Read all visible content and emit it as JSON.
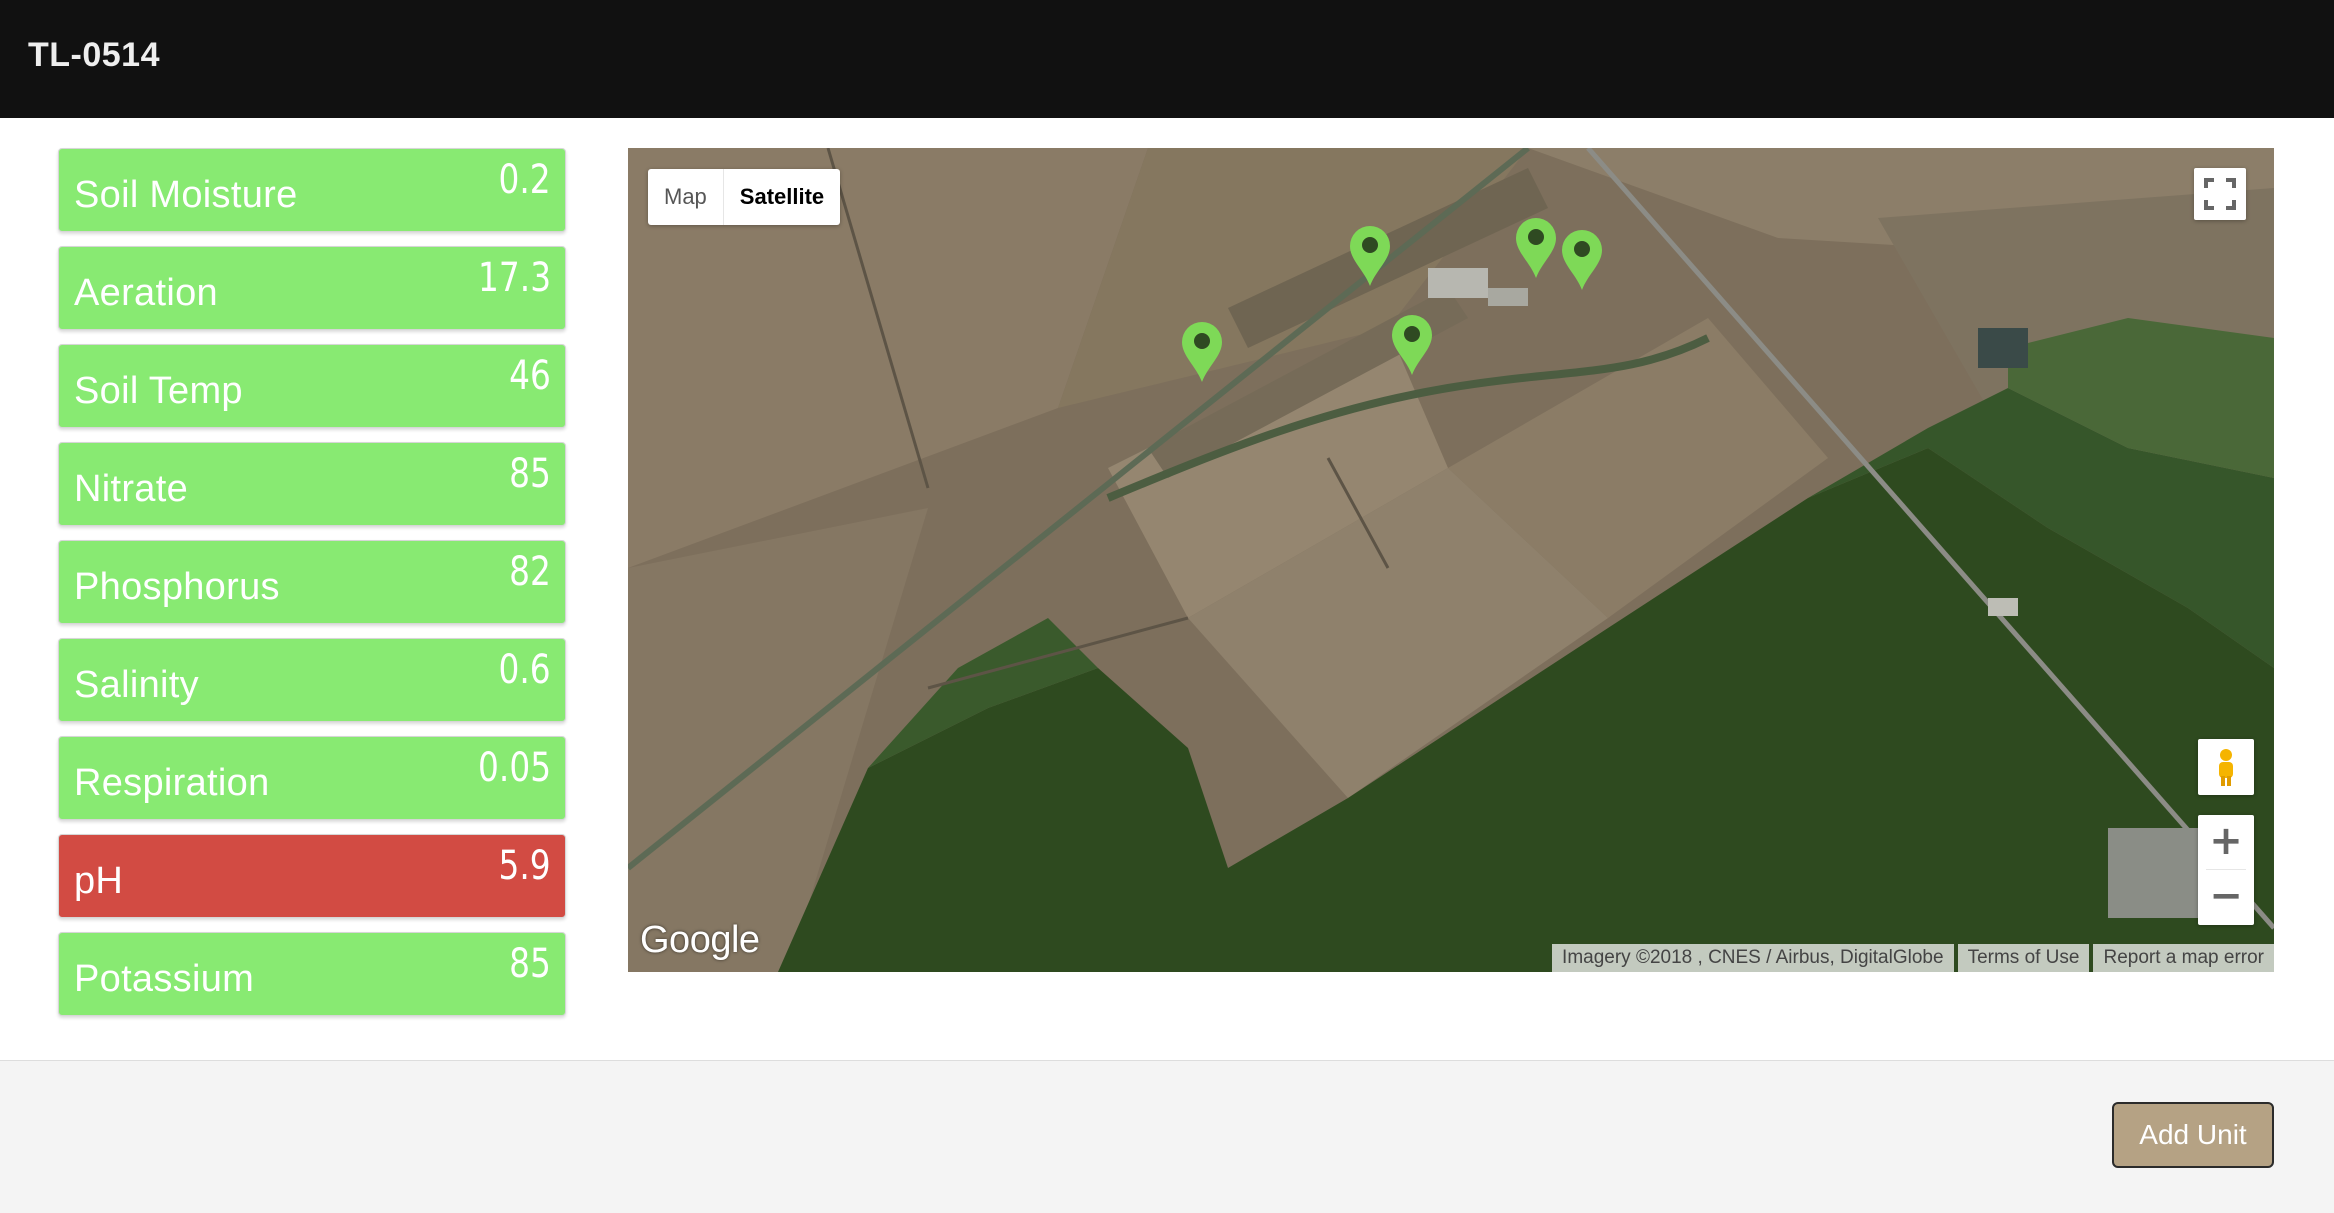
{
  "header": {
    "title": "TL-0514"
  },
  "metrics": [
    {
      "label": "Soil Moisture",
      "value": "0.2",
      "status": "good"
    },
    {
      "label": "Aeration",
      "value": "17.3",
      "status": "good"
    },
    {
      "label": "Soil Temp",
      "value": "46",
      "status": "good"
    },
    {
      "label": "Nitrate",
      "value": "85",
      "status": "good"
    },
    {
      "label": "Phosphorus",
      "value": "82",
      "status": "good"
    },
    {
      "label": "Salinity",
      "value": "0.6",
      "status": "good"
    },
    {
      "label": "Respiration",
      "value": "0.05",
      "status": "good"
    },
    {
      "label": "pH",
      "value": "5.9",
      "status": "bad"
    },
    {
      "label": "Potassium",
      "value": "85",
      "status": "good"
    }
  ],
  "map": {
    "type_map_label": "Map",
    "type_satellite_label": "Satellite",
    "active_type": "Satellite",
    "logo_text": "Google",
    "attribution": "Imagery ©2018 , CNES / Airbus, DigitalGlobe",
    "terms_label": "Terms of Use",
    "report_label": "Report a map error",
    "zoom_in_label": "+",
    "zoom_out_label": "−",
    "marker_count": 5,
    "marker_color": "#7ed957"
  },
  "footer": {
    "add_unit_label": "Add Unit"
  },
  "colors": {
    "good": "#88ea72",
    "bad": "#d24b43",
    "header": "#111111",
    "button": "#b5a284"
  }
}
